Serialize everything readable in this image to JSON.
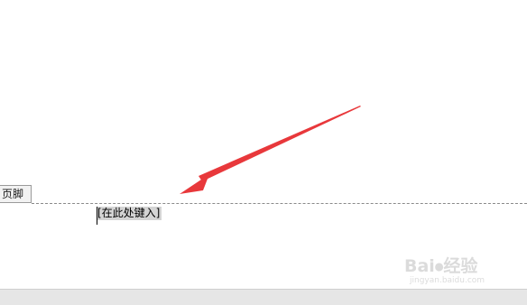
{
  "footer": {
    "label": "页脚",
    "placeholder_field": "[在此处键入]"
  },
  "watermark": {
    "brand": "Bai⦁经验",
    "sub": "jingyan.baidu.com"
  },
  "colors": {
    "arrow": "#e8383b",
    "field_highlight": "#d4d4d4",
    "status_strip": "#e6e6e6"
  }
}
